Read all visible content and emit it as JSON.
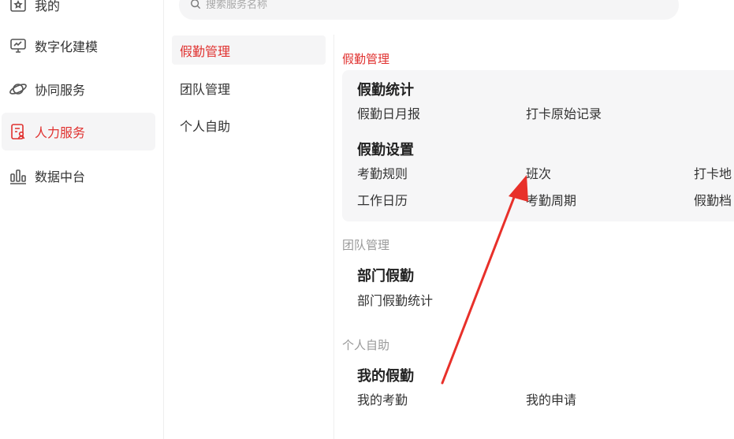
{
  "sidebar": {
    "items": [
      {
        "label": "我的",
        "icon": "star-box-icon"
      },
      {
        "label": "数字化建模",
        "icon": "monitor-chart-icon"
      },
      {
        "label": "协同服务",
        "icon": "planet-icon"
      },
      {
        "label": "人力服务",
        "icon": "person-card-icon"
      },
      {
        "label": "数据中台",
        "icon": "bar-chart-icon"
      }
    ],
    "active_index": 3
  },
  "search": {
    "placeholder": "搜索服务名称"
  },
  "categories": [
    "假勤管理",
    "团队管理",
    "个人自助"
  ],
  "content": {
    "sections": [
      {
        "title": "假勤管理",
        "groups": [
          {
            "title": "假勤统计",
            "links": [
              "假勤日月报",
              "打卡原始记录"
            ]
          },
          {
            "title": "假勤设置",
            "links": [
              "考勤规则",
              "班次",
              "打卡地",
              "工作日历",
              "考勤周期",
              "假勤档"
            ]
          }
        ]
      },
      {
        "title": "团队管理",
        "groups": [
          {
            "title": "部门假勤",
            "links": [
              "部门假勤统计"
            ]
          }
        ]
      },
      {
        "title": "个人自助",
        "groups": [
          {
            "title": "我的假勤",
            "links": [
              "我的考勤",
              "我的申请"
            ]
          }
        ]
      }
    ]
  },
  "colors": {
    "accent": "#e0312f",
    "arrow": "#e8302a"
  }
}
